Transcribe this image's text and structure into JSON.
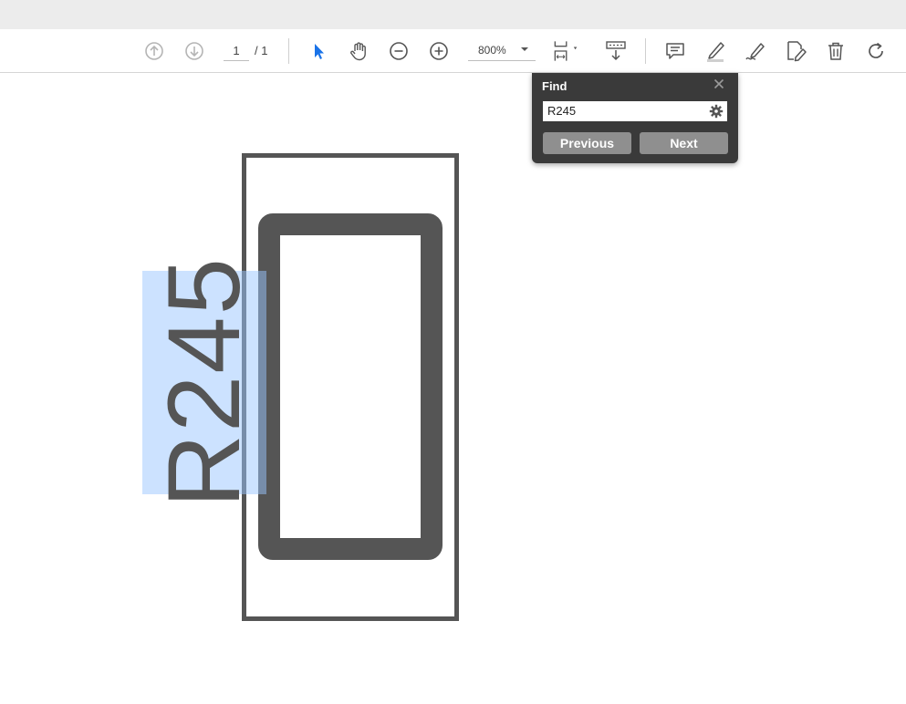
{
  "toolbar": {
    "page_current": "1",
    "page_total": "/ 1",
    "zoom_value": "800%",
    "icons": [
      "arrow-up-circle-icon",
      "arrow-down-circle-icon",
      "select-arrow-icon",
      "hand-icon",
      "zoom-out-icon",
      "zoom-in-icon",
      "page-fit-icon",
      "scroll-mode-icon",
      "comment-icon",
      "highlight-icon",
      "draw-icon",
      "edit-icon",
      "trash-icon",
      "rotate-icon"
    ]
  },
  "find": {
    "title": "Find",
    "query": "R245",
    "previous_label": "Previous",
    "next_label": "Next"
  },
  "document": {
    "component_label": "R245"
  },
  "colors": {
    "accent": "#1a73e8",
    "panel_bg": "#3a3a3a",
    "button_bg": "#8f8f8f",
    "highlight": "#99c5ff",
    "drawing": "#555555"
  }
}
